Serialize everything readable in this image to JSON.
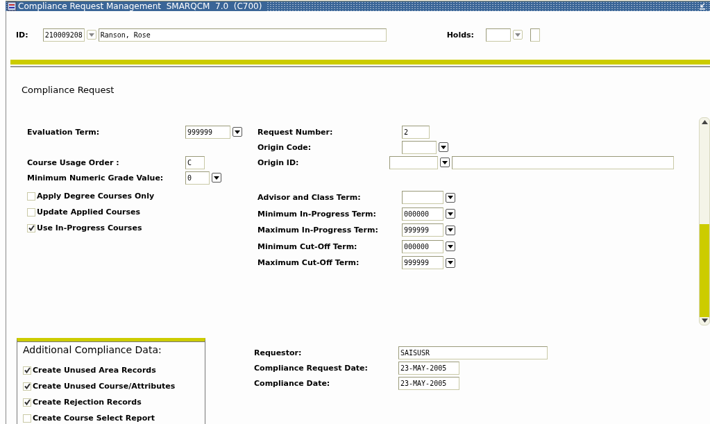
{
  "window": {
    "title": "Compliance Request Management  SMARQCM  7.0  (C700)"
  },
  "key_block": {
    "id_label": "ID:",
    "id_value": "210009208",
    "name_value": "Ranson, Rose",
    "holds_label": "Holds:"
  },
  "section_title": "Compliance Request",
  "left_fields": [
    {
      "label": "Evaluation Term:",
      "kind": "lookup",
      "value": "999999"
    },
    {
      "label": "Course Usage Order :",
      "kind": "text",
      "value": "C"
    },
    {
      "label": "Minimum Numeric Grade Value:",
      "kind": "lookup",
      "value": "0"
    }
  ],
  "left_checkboxes": [
    {
      "label": "Apply Degree Courses Only",
      "checked": false
    },
    {
      "label": "Update Applied Courses",
      "checked": false
    },
    {
      "label": "Use In-Progress Courses",
      "checked": true
    }
  ],
  "request_fields": [
    {
      "label": "Request Number:",
      "kind": "text",
      "value": "2"
    },
    {
      "label": "Origin Code:",
      "kind": "lookup"
    },
    {
      "label": "Origin ID:",
      "kind": "lookup_name"
    }
  ],
  "term_fields": [
    {
      "label": "Advisor and Class Term:",
      "kind": "lookup"
    },
    {
      "label": "Minimum In-Progress Term:",
      "kind": "lookup",
      "value": "000000"
    },
    {
      "label": "Maximum In-Progress Term:",
      "kind": "lookup",
      "value": "999999"
    },
    {
      "label": "Minimum Cut-Off Term:",
      "kind": "lookup",
      "value": "000000"
    },
    {
      "label": "Maximum Cut-Off Term:",
      "kind": "lookup",
      "value": "999999"
    }
  ],
  "additional": {
    "title": "Additional Compliance Data:",
    "checkboxes": [
      {
        "label": "Create Unused Area Records",
        "checked": true
      },
      {
        "label": "Create Unused Course/Attributes",
        "checked": true
      },
      {
        "label": "Create Rejection Records",
        "checked": true
      },
      {
        "label": "Create Course Select Report",
        "checked": false
      }
    ]
  },
  "requestor_fields": [
    {
      "label": "Requestor:",
      "kind": "text",
      "value": "SAISUSR"
    },
    {
      "label": "Compliance Request Date:",
      "kind": "text",
      "value": "23-MAY-2005"
    },
    {
      "label": "Compliance Date:",
      "kind": "text",
      "value": "23-MAY-2005"
    }
  ]
}
